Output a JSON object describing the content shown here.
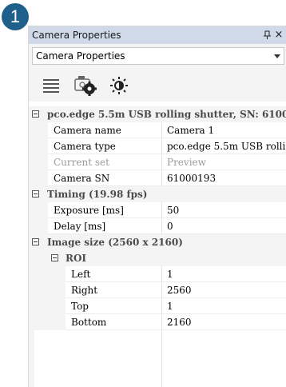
{
  "badge": "1",
  "panel": {
    "title": "Camera Properties",
    "close_label": "×",
    "selector_value": "Camera Properties"
  },
  "toolbar": {
    "icons": [
      "list-icon",
      "camera-settings-icon",
      "brightness-icon"
    ]
  },
  "groups": [
    {
      "header": "pco.edge 5.5m USB rolling shutter, SN: 6100...",
      "rows": [
        {
          "name": "Camera name",
          "value": "Camera 1"
        },
        {
          "name": "Camera type",
          "value": "pco.edge 5.5m USB rolli..."
        },
        {
          "name": "Current set",
          "value": "Preview",
          "disabled": true
        },
        {
          "name": "Camera SN",
          "value": "61000193"
        }
      ]
    },
    {
      "header": "Timing (19.98 fps)",
      "rows": [
        {
          "name": "Exposure [ms]",
          "value": "50"
        },
        {
          "name": "Delay [ms]",
          "value": "0"
        }
      ]
    },
    {
      "header": "Image size (2560 x 2160)",
      "subgroup": "ROI",
      "rows": [
        {
          "name": "Left",
          "value": "1"
        },
        {
          "name": "Right",
          "value": "2560"
        },
        {
          "name": "Top",
          "value": "1"
        },
        {
          "name": "Bottom",
          "value": "2160"
        }
      ]
    }
  ]
}
